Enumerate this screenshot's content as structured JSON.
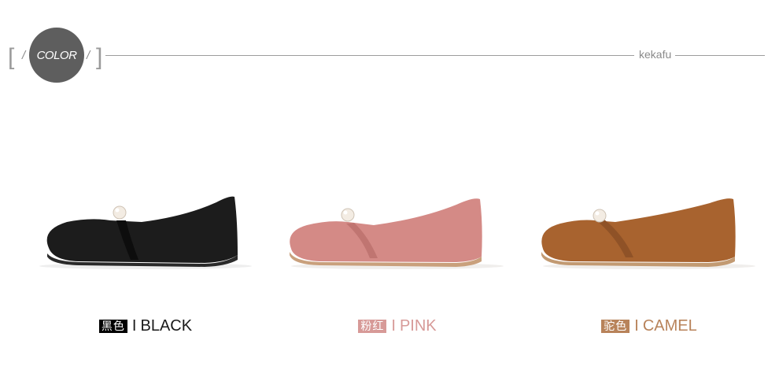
{
  "header": {
    "badge_label": "COLOR",
    "brand": "kekafu"
  },
  "colors": {
    "badge_bg": "#5e5e5e",
    "rule": "#9c9c9c"
  },
  "products": [
    {
      "cn": "黑色",
      "sep": "I",
      "en": "BLACK",
      "tag_color": "#000000",
      "text_color": "#1a1a1a",
      "upper": "#1c1c1c",
      "upper_dark": "#0d0d0d",
      "sole": "#2a2a2a"
    },
    {
      "cn": "粉红",
      "sep": "I",
      "en": "PINK",
      "tag_color": "#d79a98",
      "text_color": "#d79a98",
      "upper": "#d48a86",
      "upper_dark": "#c07571",
      "sole": "#c9a07c"
    },
    {
      "cn": "驼色",
      "sep": "I",
      "en": "CAMEL",
      "tag_color": "#b8835a",
      "text_color": "#b8835a",
      "upper": "#a8632f",
      "upper_dark": "#8f5227",
      "sole": "#c29a72"
    }
  ]
}
